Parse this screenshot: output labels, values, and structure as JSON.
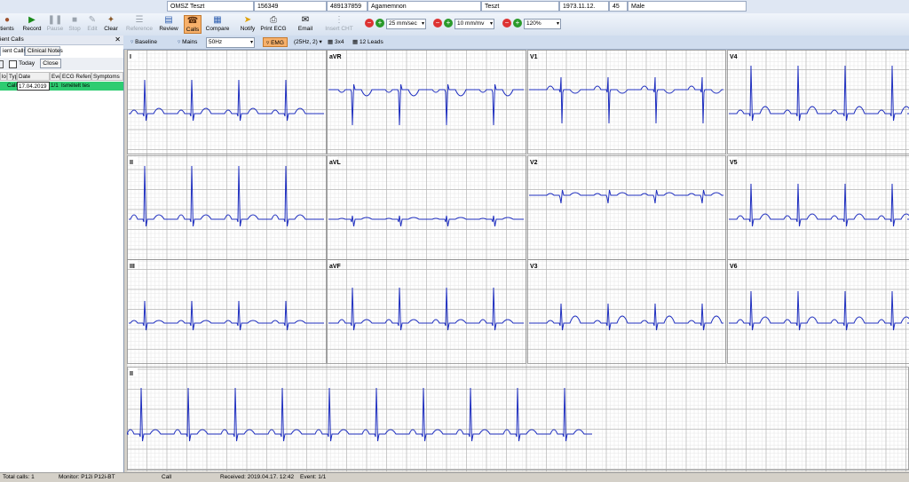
{
  "patient_bar": {
    "facility": "OMSZ Teszt",
    "id_number": "156349",
    "ssn": "489137859",
    "first_name": "Agamemnon",
    "last_name": "Teszt",
    "birth_date": "1973.11.12.",
    "age": "45",
    "sex": "Male"
  },
  "toolbar": {
    "patients": "tients",
    "record": "Record",
    "pause": "Pause",
    "stop": "Stop",
    "edit": "Edit",
    "clear": "Clear",
    "reference": "Reference",
    "review": "Review",
    "calls": "Calls",
    "compare": "Compare",
    "notify": "Notify",
    "print_ecg": "Print ECG",
    "email": "Email",
    "insert_cht": "Insert CHT",
    "paper_speed": "25 mm/sec",
    "gain": "10 mm/mv",
    "zoom": "120%"
  },
  "left_panel": {
    "title": "ient Calls",
    "tabs": [
      "ient Calls",
      "Clinical Notes"
    ],
    "today_label": "Today",
    "close_label": "Close",
    "columns": [
      "lo",
      "Typ",
      "Date",
      "Eve",
      "ECG Referr",
      "Symptoms"
    ],
    "rows": [
      {
        "type": "Call",
        "date": "17.04.2019",
        "event": "1/1",
        "ecg_ref": "Ismételt tes",
        "symptoms": ""
      }
    ]
  },
  "ecg_bar": {
    "baseline": "Baseline",
    "mains": "Mains",
    "mains_value": "50Hz",
    "emg": "EMG",
    "emg_value": "(25Hz, 2)",
    "layout": "3x4",
    "leads": "12 Leads"
  },
  "ecg": {
    "leads": [
      "I",
      "aVR",
      "V1",
      "V4",
      "II",
      "aVL",
      "V2",
      "V5",
      "III",
      "aVF",
      "V3",
      "V6"
    ],
    "rhythm_lead": "II",
    "trace_color": "#1f2fbf",
    "grid_major_color": "#b8b8b8",
    "grid_minor_color": "#e6e6e6"
  },
  "status": {
    "total_calls": "Total calls: 1",
    "monitor": "Monitor: P12i P12i-BT",
    "type": "Call",
    "received": "Received: 2019.04.17. 12:42",
    "event": "Event: 1/1"
  }
}
